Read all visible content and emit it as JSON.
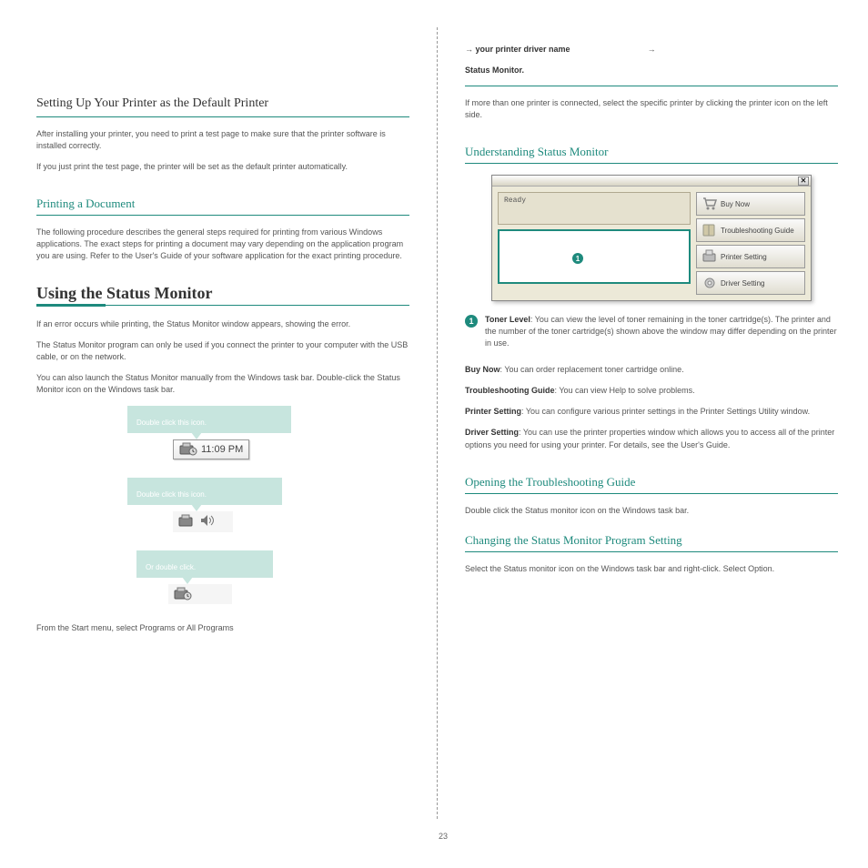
{
  "left": {
    "setup_heading": "Setting Up Your Printer as the Default Printer",
    "sub_after": "After installing your printer, you need to print a test page to make sure that the printer software is installed correctly.",
    "step_prefix": "If you just print the test page, the printer will be set as the default printer automatically.",
    "print_heading": "Printing a Document",
    "print_p1": "The following procedure describes the general steps required for printing from various Windows applications. The exact steps for printing a document may vary depending on the application program you are using. Refer to the User's Guide of your software application for the exact printing procedure.",
    "tray_heading": "Using the Status Monitor",
    "tray_p": "If an error occurs while printing, the Status Monitor window appears, showing the error.",
    "tray_note": "The Status Monitor program can only be used if you connect the printer to your computer with the USB cable, or on the network.",
    "tray_p2": "You can also launch the Status Monitor manually from the Windows task bar. Double-click the Status Monitor icon on the Windows task bar.",
    "label1": "Double click this icon.",
    "time": "11:09 PM",
    "label2": "Double click this icon.",
    "label3": "Or double click.",
    "bottom_p": "From the Start menu, select Programs or All Programs"
  },
  "right": {
    "top_path": "your printer driver name",
    "top_path2": "Status Monitor.",
    "under_heading1": "Understanding Status Monitor",
    "p1a": "If more than one printer is connected, select the specific printer by clicking the printer icon on the left side.",
    "p1b": "",
    "sw": {
      "ready": "Ready",
      "btn1": "Buy Now",
      "btn2": "Troubleshooting Guide",
      "btn3": "Printer Setting",
      "btn4": "Driver Setting",
      "callout_num": "1"
    },
    "bullet_num": "1",
    "bullet_head": "Toner Level",
    "bullet_text": ": You can view the level of toner remaining in the toner cartridge(s). The printer and the number of the toner cartridge(s) shown above the window may differ depending on the printer in use.",
    "buynow_head": "Buy Now",
    "buynow_text": ": You can order replacement toner cartridge online.",
    "trouble_head": "Troubleshooting Guide",
    "trouble_text": ": You can view Help to solve problems.",
    "psetting_head": "Printer Setting",
    "psetting_text": ": You can configure various printer settings in the Printer Settings Utility window.",
    "dsetting_head": "Driver Setting",
    "dsetting_text": ": You can use the printer properties window which allows you to access all of the printer options you need for using your printer. For details, see the User's Guide.",
    "open_heading": "Opening the Troubleshooting Guide",
    "open_text": "Double click the Status monitor icon on the Windows task bar.",
    "change_heading": "Changing the Status Monitor Program Setting",
    "change_text": "Select the Status monitor icon on the Windows task bar and right-click. Select Option."
  },
  "pagenum": "23"
}
